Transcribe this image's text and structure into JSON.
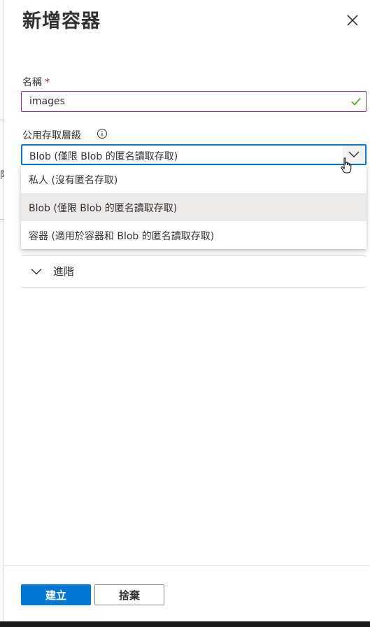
{
  "panel": {
    "title": "新增容器",
    "close_icon": "close-icon"
  },
  "name_field": {
    "label": "名稱",
    "required_mark": "*",
    "value": "images",
    "valid_icon": "checkmark-icon",
    "border_color": "#8a2da5",
    "check_color": "#57a300"
  },
  "access_level": {
    "label": "公用存取層級",
    "info_icon": "info-icon",
    "selected_value": "Blob (僅限 Blob 的匿名讀取存取)",
    "options": [
      {
        "label": "私人 (沒有匿名存取)"
      },
      {
        "label": "Blob (僅限 Blob 的匿名讀取存取)",
        "selected": true
      },
      {
        "label": "容器 (適用於容器和 Blob 的匿名讀取存取)"
      }
    ],
    "focus_color": "#0078d4"
  },
  "advanced": {
    "label": "進階",
    "icon": "chevron-down-icon"
  },
  "footer": {
    "create_label": "建立",
    "discard_label": "捨棄"
  },
  "background": {
    "partial_glyph": "限"
  }
}
